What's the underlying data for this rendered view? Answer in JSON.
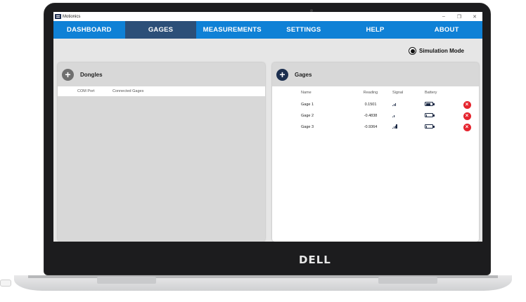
{
  "window": {
    "title": "Motionics",
    "minimize_icon": "–",
    "maximize_icon": "❐",
    "close_icon": "✕"
  },
  "nav": {
    "tabs": [
      {
        "label": "DASHBOARD"
      },
      {
        "label": "GAGES"
      },
      {
        "label": "MEASUREMENTS"
      },
      {
        "label": "SETTINGS"
      },
      {
        "label": "HELP"
      },
      {
        "label": "ABOUT"
      }
    ],
    "active": "GAGES"
  },
  "simulation": {
    "label": "Simulation Mode",
    "selected": true
  },
  "dongles": {
    "title": "Dongles",
    "add_icon": "+",
    "columns": [
      "COM Port",
      "Connected Gages"
    ]
  },
  "gages": {
    "title": "Gages",
    "add_icon": "+",
    "columns": {
      "name": "Name",
      "reading": "Reading",
      "signal": "Signal",
      "battery": "Battery"
    },
    "rows": [
      {
        "name": "Gage 1",
        "reading": "0.1501",
        "signal_bars": 3,
        "battery_level": 0.7
      },
      {
        "name": "Gage 2",
        "reading": "-0.4838",
        "signal_bars": 2,
        "battery_level": 0.1
      },
      {
        "name": "Gage 3",
        "reading": "-0.9364",
        "signal_bars": 4,
        "battery_level": 0.1
      }
    ],
    "remove_icon": "×"
  },
  "device": {
    "brand": "DELL"
  },
  "colors": {
    "nav_bg": "#0f81d6",
    "nav_active": "#2c4f78",
    "remove": "#e5242e",
    "icon_dark": "#1c2a45"
  }
}
